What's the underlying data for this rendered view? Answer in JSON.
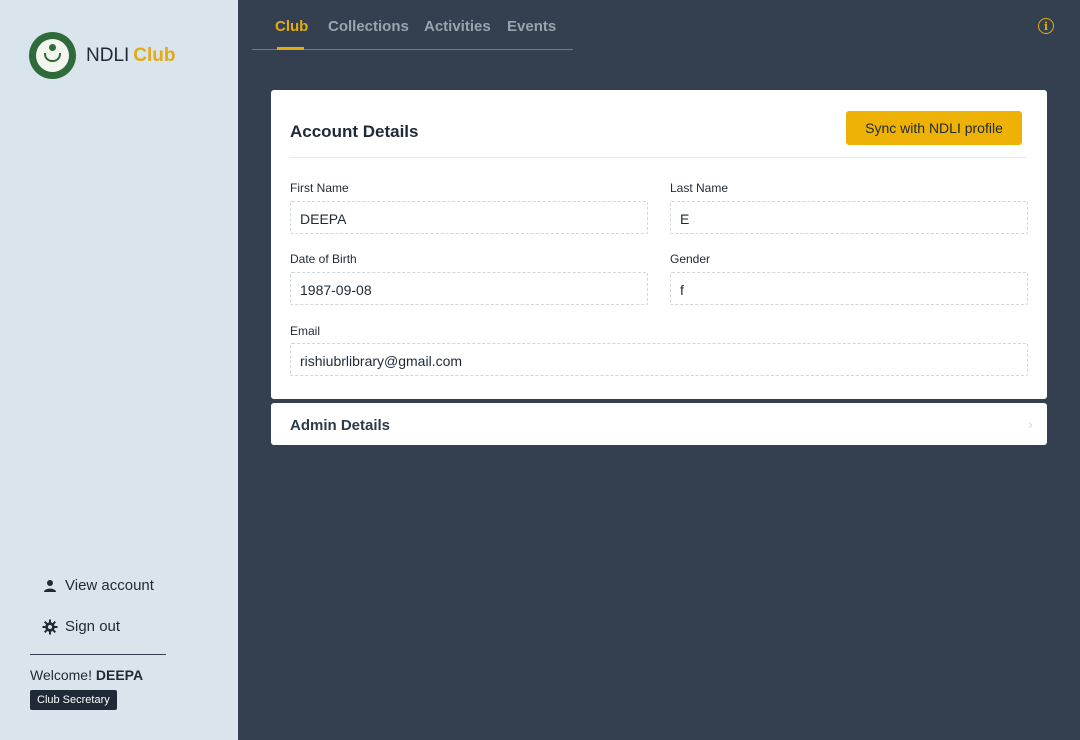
{
  "sidebar": {
    "brand_name": "NDLI",
    "brand_club": "Club",
    "view_account": "View account",
    "sign_out": "Sign out",
    "welcome_prefix": "Welcome!",
    "welcome_user": "DEEPA",
    "role": "Club Secretary"
  },
  "tabs": [
    {
      "label": "Club",
      "active": true
    },
    {
      "label": "Collections",
      "active": false
    },
    {
      "label": "Activities",
      "active": false
    },
    {
      "label": "Events",
      "active": false
    }
  ],
  "account": {
    "title": "Account Details",
    "sync_button": "Sync with NDLI profile",
    "first_name_label": "First Name",
    "first_name": "DEEPA",
    "last_name_label": "Last Name",
    "last_name": "E",
    "dob_label": "Date of Birth",
    "dob": "1987-09-08",
    "gender_label": "Gender",
    "gender": "f",
    "email_label": "Email",
    "email": "rishiubrlibrary@gmail.com"
  },
  "admin": {
    "title": "Admin Details"
  },
  "icons": {
    "info": "info-icon",
    "user": "user-icon",
    "gear": "gear-icon",
    "chevron": "chevron-right-icon"
  },
  "colors": {
    "accent": "#e3aa12",
    "sync_button": "#eeb206",
    "background": "#34404f",
    "sidebar": "#d9e4ec"
  }
}
